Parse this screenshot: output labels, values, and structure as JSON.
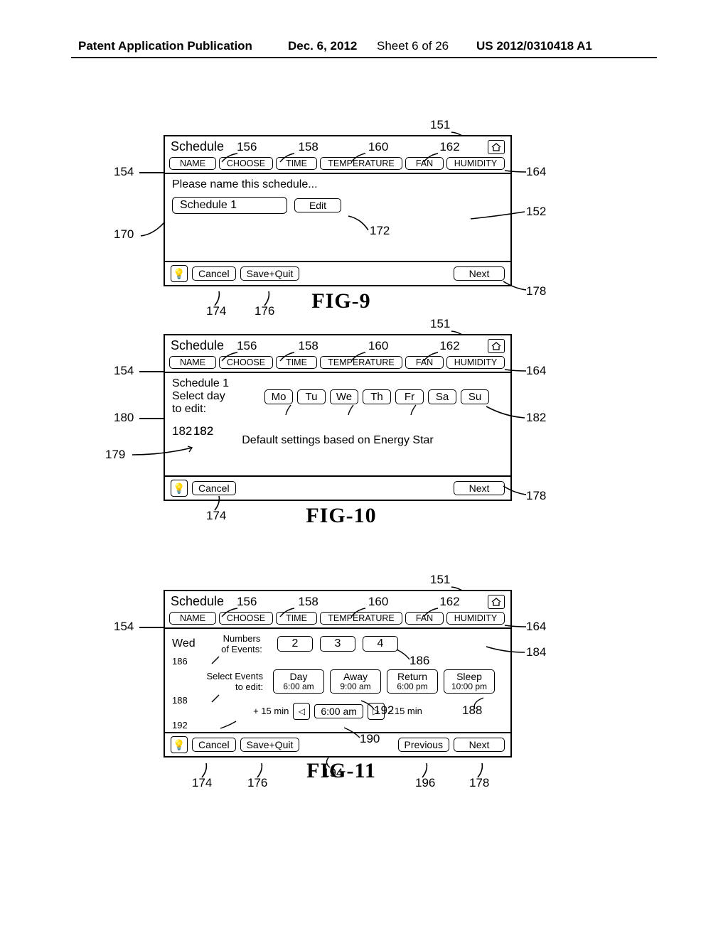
{
  "header": {
    "left": "Patent Application Publication",
    "date": "Dec. 6, 2012",
    "sheet": "Sheet 6 of 26",
    "pubno": "US 2012/0310418 A1"
  },
  "tabs": {
    "name": "NAME",
    "choose": "CHOOSE",
    "time": "TIME",
    "temperature": "TEMPERATURE",
    "fan": "FAN",
    "humidity": "HUMIDITY"
  },
  "common": {
    "schedule_title": "Schedule",
    "cancel": "Cancel",
    "savequit": "Save+Quit",
    "next": "Next",
    "previous": "Previous",
    "help": "?"
  },
  "fig9": {
    "label": "FIG-9",
    "prompt": "Please name this schedule...",
    "name_value": "Schedule 1",
    "edit": "Edit",
    "refs": {
      "r151": "151",
      "r152": "152",
      "r154": "154",
      "r156": "156",
      "r158": "158",
      "r160": "160",
      "r162": "162",
      "r164": "164",
      "r170": "170",
      "r172": "172",
      "r174": "174",
      "r176": "176",
      "r178": "178"
    }
  },
  "fig10": {
    "label": "FIG-10",
    "schedname": "Schedule 1",
    "selectday": "Select day",
    "toedit": "to edit:",
    "days": [
      "Mo",
      "Tu",
      "We",
      "Th",
      "Fr",
      "Sa",
      "Su"
    ],
    "default_note": "Default settings based on Energy Star",
    "refs": {
      "r151": "151",
      "r154": "154",
      "r156": "156",
      "r158": "158",
      "r160": "160",
      "r162": "162",
      "r164": "164",
      "r174": "174",
      "r178": "178",
      "r179": "179",
      "r180": "180",
      "r182a": "182",
      "r182b": "182",
      "r182c": "182",
      "r182d": "182"
    }
  },
  "fig11": {
    "label": "FIG-11",
    "wed": "Wed",
    "numlabel1": "Numbers",
    "numlabel2": "of Events:",
    "nums": [
      "2",
      "3",
      "4"
    ],
    "sel1": "Select Events",
    "sel2": "to edit:",
    "events": [
      {
        "name": "Day",
        "time": "6:00 am"
      },
      {
        "name": "Away",
        "time": "9:00 am"
      },
      {
        "name": "Return",
        "time": "6:00 pm"
      },
      {
        "name": "Sleep",
        "time": "10:00 pm"
      }
    ],
    "plus": "+ 15 min",
    "minus": "- 15 min",
    "stepval": "6:00 am",
    "refs": {
      "r151": "151",
      "r154": "154",
      "r156": "156",
      "r158": "158",
      "r160": "160",
      "r162": "162",
      "r164": "164",
      "r174": "174",
      "r176": "176",
      "r178": "178",
      "r184": "184",
      "r186a": "186",
      "r186b": "186",
      "r188a": "188",
      "r188b": "188",
      "r190": "190",
      "r192a": "192",
      "r192b": "192",
      "r194": "194",
      "r196": "196"
    }
  }
}
